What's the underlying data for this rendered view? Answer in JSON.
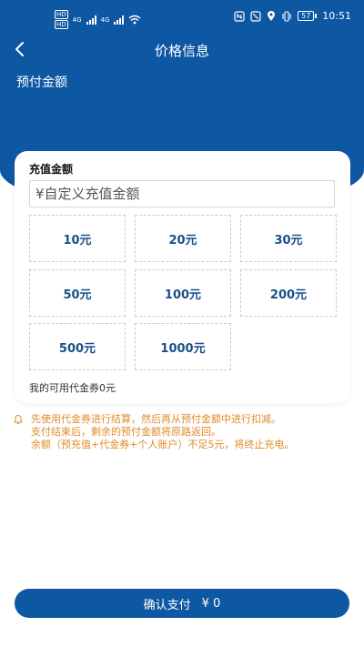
{
  "status_bar": {
    "carrier_tags": [
      "HD",
      "HD"
    ],
    "network_left": "4G",
    "network_right": "4G",
    "time": "10:51",
    "battery": "57"
  },
  "header": {
    "back_icon": "chevron-left-icon",
    "title": "价格信息",
    "section_heading": "预付金额"
  },
  "recharge": {
    "title": "充值金额",
    "input_placeholder": "¥自定义充值金额",
    "input_value": "",
    "options": [
      "10元",
      "20元",
      "30元",
      "50元",
      "100元",
      "200元",
      "500元",
      "1000元"
    ],
    "voucher_text": "我的可用代金券0元"
  },
  "notice": {
    "icon": "bell-icon",
    "lines": [
      "先使用代金券进行结算，然后再从预付金额中进行扣减。",
      "支付结束后，剩余的预付金额将原路返回。",
      "余额（预充值+代金券+个人账户）不足5元，将终止充电。"
    ]
  },
  "footer": {
    "pay_label": "确认支付",
    "pay_amount": "¥ 0"
  },
  "colors": {
    "primary": "#0e57a3",
    "option_text": "#1a4f88",
    "notice": "#e18a2b"
  }
}
